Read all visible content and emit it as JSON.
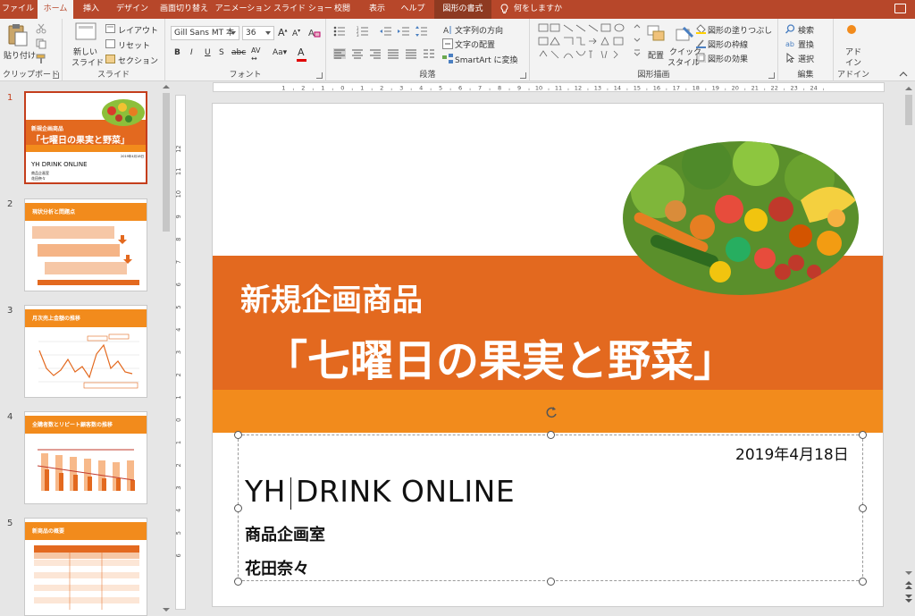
{
  "tabs": [
    "ファイル",
    "ホーム",
    "挿入",
    "デザイン",
    "画面切り替え",
    "アニメーション",
    "スライド ショー",
    "校閲",
    "表示",
    "ヘルプ",
    "図形の書式"
  ],
  "active_tab": "ホーム",
  "tellme": "何をしますか",
  "ribbon": {
    "clipboard": {
      "paste": "貼り付け",
      "label": "クリップボード"
    },
    "slides": {
      "new_slide_1": "新しい",
      "new_slide_2": "スライド",
      "layout": "レイアウト",
      "reset": "リセット",
      "section": "セクション",
      "label": "スライド"
    },
    "font": {
      "font_name": "Gill Sans MT 本",
      "font_size": "36",
      "label": "フォント"
    },
    "paragraph": {
      "text_direction": "文字列の方向",
      "align_text": "文字の配置",
      "smartart": "SmartArt に変換",
      "label": "段落"
    },
    "drawing": {
      "arrange": "配置",
      "quick_style_1": "クイック",
      "quick_style_2": "スタイル",
      "shape_fill": "図形の塗りつぶし",
      "shape_outline": "図形の枠線",
      "shape_effects": "図形の効果",
      "label": "図形描画"
    },
    "editing": {
      "find": "検索",
      "replace": "置換",
      "select": "選択",
      "label": "編集"
    },
    "addins": {
      "line1": "アド",
      "line2": "イン",
      "label": "アドイン"
    }
  },
  "ruler": {
    "h": [
      "1",
      "2",
      "1",
      "0",
      "1",
      "2",
      "3",
      "4",
      "5",
      "6",
      "7",
      "8",
      "9",
      "10",
      "11",
      "12",
      "13",
      "14",
      "15",
      "16",
      "17",
      "18",
      "19",
      "20",
      "21",
      "22",
      "23",
      "24"
    ],
    "v": [
      "12",
      "11",
      "10",
      "9",
      "8",
      "7",
      "6",
      "5",
      "4",
      "3",
      "2",
      "1",
      "0",
      "1",
      "2",
      "3",
      "4",
      "5",
      "6"
    ]
  },
  "slide_numbers": [
    "1",
    "2",
    "3",
    "4",
    "5"
  ],
  "thumbs": {
    "t1": {
      "sub": "新規企画商品",
      "title": "「七曜日の果実と野菜」",
      "date": "2019年4月18日",
      "company": "YH DRINK ONLINE",
      "dept": "商品企画室",
      "person": "花田奈々"
    },
    "t2": {
      "title": "現状分析と問題点"
    },
    "t3": {
      "title": "月次売上金額の推移"
    },
    "t4": {
      "title": "全購者数とリピート顧客数の推移"
    },
    "t5": {
      "title": "新商品の概要"
    }
  },
  "slide": {
    "subtitle": "新規企画商品",
    "title": "「七曜日の果実と野菜」",
    "date": "2019年4月18日",
    "company": "YH DRINK ONLINE",
    "dept": "商品企画室",
    "person": "花田奈々"
  },
  "colors": {
    "accent": "#b7472a",
    "band_dark": "#e3691f",
    "band_light": "#f28b1c"
  }
}
